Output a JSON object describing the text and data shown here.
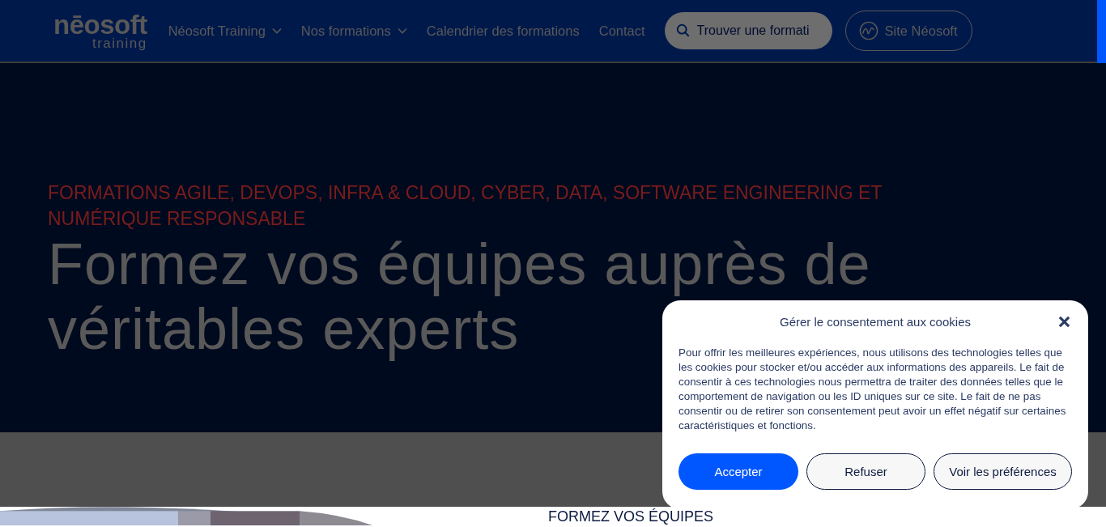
{
  "header": {
    "logo": {
      "name": "nēosoft",
      "sub": "training"
    },
    "nav": [
      {
        "label": "Néosoft Training",
        "kind": "dropdown"
      },
      {
        "label": "Nos formations",
        "kind": "dropdown"
      },
      {
        "label": "Calendrier des formations",
        "kind": "link"
      },
      {
        "label": "Contact",
        "kind": "link"
      }
    ],
    "search": {
      "placeholder": "Trouver une formati"
    },
    "site_button": "Site Néosoft"
  },
  "hero": {
    "kicker": "FORMATIONS AGILE, DEVOPS, INFRA & CLOUD, CYBER, DATA, SOFTWARE ENGINEERING ET NUMÉRIQUE RESPONSABLE",
    "title_lines": [
      "Formez vos équipes auprès de",
      "véritables experts"
    ]
  },
  "section": {
    "heading": "FORMEZ VOS ÉQUIPES"
  },
  "cookie_dialog": {
    "title": "Gérer le consentement aux cookies",
    "text": "Pour offrir les meilleures expériences, nous utilisons des technologies telles que les cookies pour stocker et/ou accéder aux informations des appareils. Le fait de consentir à ces technologies nous permettra de traiter des données telles que le comportement de navigation ou les ID uniques sur ce site. Le fait de ne pas consentir ou de retirer son consentement peut avoir un effet négatif sur certaines caractéristiques et fonctions.",
    "buttons": [
      {
        "label": "Accepter",
        "kind": "primary"
      },
      {
        "label": "Refuser",
        "kind": "secondary"
      },
      {
        "label": "Voir les préférences",
        "kind": "secondary"
      }
    ]
  }
}
